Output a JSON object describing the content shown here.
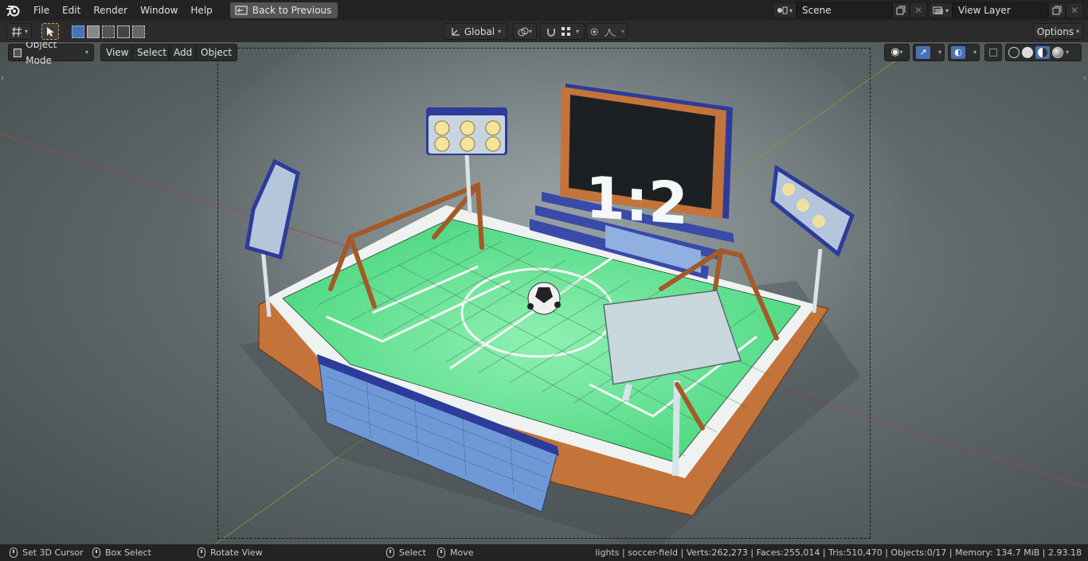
{
  "menubar": {
    "items": [
      "File",
      "Edit",
      "Render",
      "Window",
      "Help"
    ],
    "back_button": "Back to Previous",
    "scene_label": "Scene",
    "view_layer_label": "View Layer"
  },
  "toolbar": {
    "transform_orientation": "Global",
    "options_label": "Options"
  },
  "viewport_header": {
    "mode_label": "Object Mode",
    "menu": [
      "View",
      "Select",
      "Add",
      "Object"
    ]
  },
  "scoreboard": {
    "score": "1:2"
  },
  "statusbar": {
    "left_items": [
      "Set 3D Cursor",
      "Box Select",
      "Rotate View",
      "Select",
      "Move"
    ],
    "stats": "lights | soccer-field | Verts:262,273 | Faces:255,014 | Tris:510,470 | Objects:0/17 | Memory: 134.7 MiB | 2.93.18"
  },
  "colors": {
    "accent_blue": "#4772b3",
    "selected_tool": "#e3a520",
    "field_green": "#58e08a",
    "pitch_border_orange": "#c4743a",
    "stand_blue": "#3a4aa8"
  },
  "icons": [
    "blender-logo-icon",
    "back-icon",
    "scene-icon",
    "view-layer-icon",
    "cursor-tool-icon",
    "box-select-mode-icons",
    "orientation-icon",
    "pivot-icon",
    "snap-icon",
    "proportional-icon",
    "viewport-shading-icons",
    "mouse-icon"
  ]
}
